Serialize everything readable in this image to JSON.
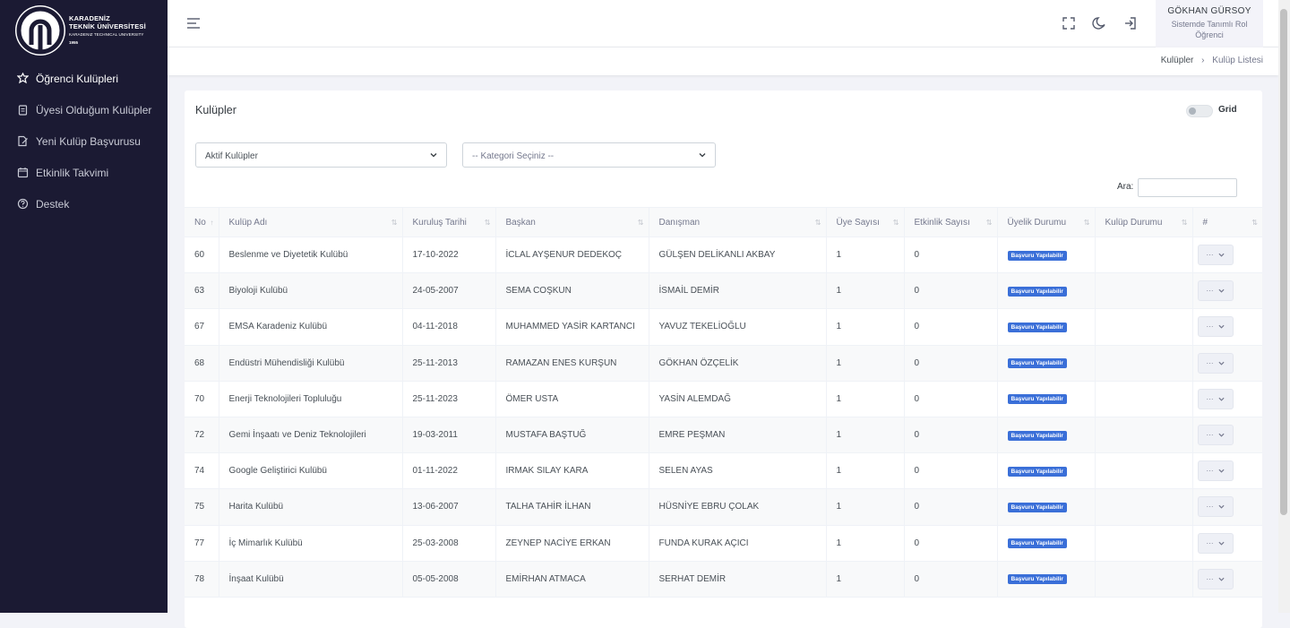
{
  "brand": {
    "line1": "KARADENİZ",
    "line2": "TEKNİK ÜNİVERSİTESİ",
    "line3": "KARADENIZ TECHNICAL UNIVERSITY",
    "line4": "1955"
  },
  "sidebar": {
    "items": [
      {
        "label": "Öğrenci Kulüpleri",
        "icon": "club-icon",
        "active": true
      },
      {
        "label": "Üyesi Olduğum Kulüpler",
        "icon": "clipboard-icon"
      },
      {
        "label": "Yeni Kulüp Başvurusu",
        "icon": "document-edit-icon"
      },
      {
        "label": "Etkinlik Takvimi",
        "icon": "calendar-icon"
      },
      {
        "label": "Destek",
        "icon": "help-circle-icon"
      }
    ]
  },
  "user": {
    "name": "GÖKHAN GÜRSOY",
    "role_line1": "Sistemde Tanımlı Rol",
    "role_line2": "Öğrenci"
  },
  "breadcrumb": {
    "parent": "Kulüpler",
    "current": "Kulüp Listesi"
  },
  "card": {
    "title": "Kulüpler",
    "grid_label": "Grid"
  },
  "filters": {
    "status_selected": "Aktif Kulüpler",
    "category_placeholder": "-- Kategori Seçiniz --"
  },
  "search": {
    "label": "Ara:",
    "value": ""
  },
  "table": {
    "columns": [
      "No",
      "Kulüp Adı",
      "Kuruluş Tarihi",
      "Başkan",
      "Danışman",
      "Üye Sayısı",
      "Etkinlik Sayısı",
      "Üyelik Durumu",
      "Kulüp Durumu",
      "#"
    ],
    "action_label": "···",
    "rows": [
      {
        "no": "60",
        "name": "Beslenme ve Diyetetik Kulübü",
        "date": "17-10-2022",
        "president": "İCLAL AYŞENUR DEDEKOÇ",
        "advisor": "GÜLŞEN DELİKANLI AKBAY",
        "members": "1",
        "events": "0",
        "membership": "Başvuru Yapılabilir",
        "status": ""
      },
      {
        "no": "63",
        "name": "Biyoloji Kulübü",
        "date": "24-05-2007",
        "president": "SEMA COŞKUN",
        "advisor": "İSMAİL DEMİR",
        "members": "1",
        "events": "0",
        "membership": "Başvuru Yapılabilir",
        "status": ""
      },
      {
        "no": "67",
        "name": "EMSA Karadeniz Kulübü",
        "date": "04-11-2018",
        "president": "MUHAMMED YASİR KARTANCI",
        "advisor": "YAVUZ TEKELİOĞLU",
        "members": "1",
        "events": "0",
        "membership": "Başvuru Yapılabilir",
        "status": ""
      },
      {
        "no": "68",
        "name": "Endüstri Mühendisliği Kulübü",
        "date": "25-11-2013",
        "president": "RAMAZAN ENES KURŞUN",
        "advisor": "GÖKHAN ÖZÇELİK",
        "members": "1",
        "events": "0",
        "membership": "Başvuru Yapılabilir",
        "status": ""
      },
      {
        "no": "70",
        "name": "Enerji Teknolojileri Topluluğu",
        "date": "25-11-2023",
        "president": "ÖMER USTA",
        "advisor": "YASİN ALEMDAĞ",
        "members": "1",
        "events": "0",
        "membership": "Başvuru Yapılabilir",
        "status": ""
      },
      {
        "no": "72",
        "name": "Gemi İnşaatı ve Deniz Teknolojileri",
        "date": "19-03-2011",
        "president": "MUSTAFA BAŞTUĞ",
        "advisor": "EMRE PEŞMAN",
        "members": "1",
        "events": "0",
        "membership": "Başvuru Yapılabilir",
        "status": ""
      },
      {
        "no": "74",
        "name": "Google Geliştirici Kulübü",
        "date": "01-11-2022",
        "president": "IRMAK SILAY KARA",
        "advisor": "SELEN AYAS",
        "members": "1",
        "events": "0",
        "membership": "Başvuru Yapılabilir",
        "status": ""
      },
      {
        "no": "75",
        "name": "Harita Kulübü",
        "date": "13-06-2007",
        "president": "TALHA TAHİR İLHAN",
        "advisor": "HÜSNİYE EBRU ÇOLAK",
        "members": "1",
        "events": "0",
        "membership": "Başvuru Yapılabilir",
        "status": ""
      },
      {
        "no": "77",
        "name": "İç Mimarlık Kulübü",
        "date": "25-03-2008",
        "president": "ZEYNEP NACİYE ERKAN",
        "advisor": "FUNDA KURAK AÇICI",
        "members": "1",
        "events": "0",
        "membership": "Başvuru Yapılabilir",
        "status": ""
      },
      {
        "no": "78",
        "name": "İnşaat Kulübü",
        "date": "05-05-2008",
        "president": "EMİRHAN ATMACA",
        "advisor": "SERHAT DEMİR",
        "members": "1",
        "events": "0",
        "membership": "Başvuru Yapılabilir",
        "status": ""
      }
    ]
  },
  "colors": {
    "sidebar_bg": "#1b1a33",
    "badge_bg": "#3a6fd8"
  }
}
